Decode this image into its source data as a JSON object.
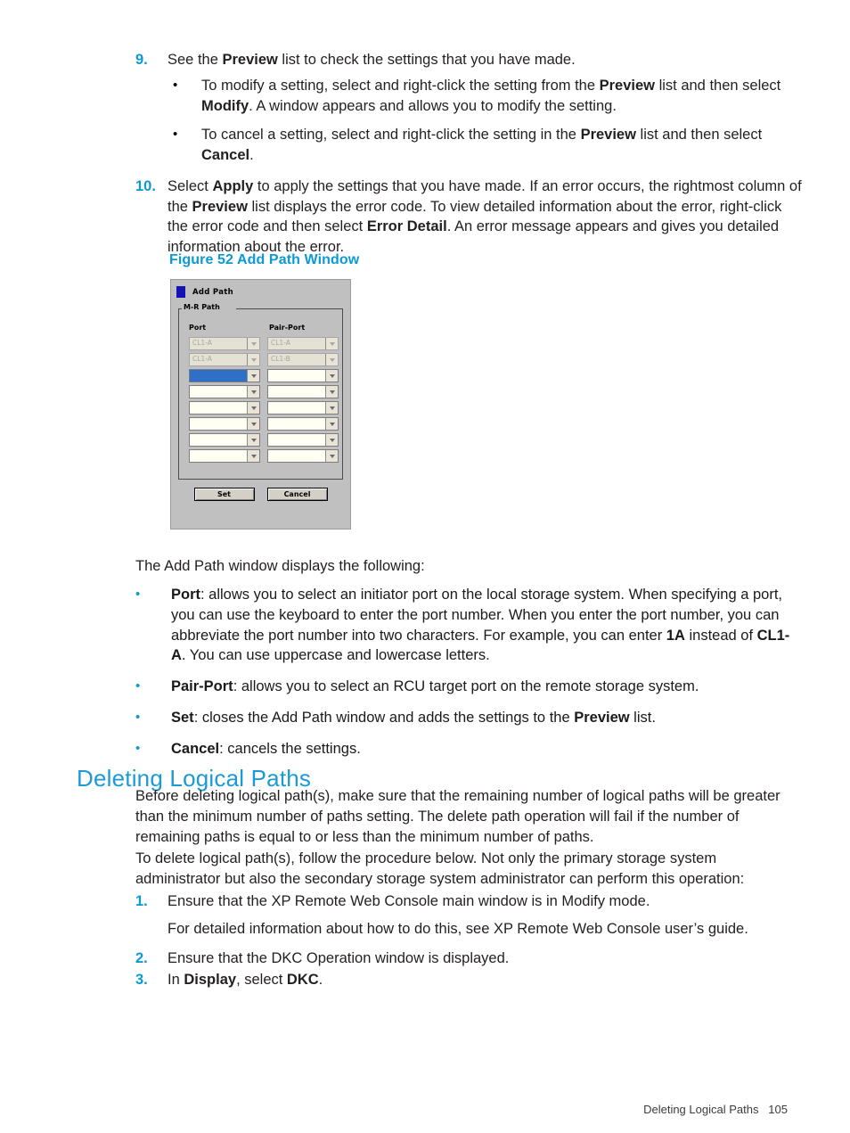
{
  "steps_top": [
    {
      "marker": "9.",
      "text_parts": [
        {
          "t": "See the ",
          "b": false
        },
        {
          "t": "Preview",
          "b": true
        },
        {
          "t": " list to check the settings that you have made.",
          "b": false
        }
      ],
      "sub_bullets": [
        {
          "marker": "•",
          "text_parts": [
            {
              "t": "To modify a setting, select and right-click the setting from the ",
              "b": false
            },
            {
              "t": "Preview",
              "b": true
            },
            {
              "t": " list and then select ",
              "b": false
            },
            {
              "t": "Modify",
              "b": true
            },
            {
              "t": ". A window appears and allows you to modify the setting.",
              "b": false
            }
          ]
        },
        {
          "marker": "•",
          "text_parts": [
            {
              "t": "To cancel a setting, select and right-click the setting in the ",
              "b": false
            },
            {
              "t": "Preview",
              "b": true
            },
            {
              "t": " list and then select ",
              "b": false
            },
            {
              "t": "Cancel",
              "b": true
            },
            {
              "t": ".",
              "b": false
            }
          ]
        }
      ]
    },
    {
      "marker": "10.",
      "text_parts": [
        {
          "t": "Select ",
          "b": false
        },
        {
          "t": "Apply",
          "b": true
        },
        {
          "t": " to apply the settings that you have made. If an error occurs, the rightmost column of the ",
          "b": false
        },
        {
          "t": "Preview",
          "b": true
        },
        {
          "t": " list displays the error code. To view detailed information about the error, right-click the error code and then select ",
          "b": false
        },
        {
          "t": "Error Detail",
          "b": true
        },
        {
          "t": ". An error message appears and gives you detailed information about the error.",
          "b": false
        }
      ],
      "sub_bullets": []
    }
  ],
  "figure": {
    "caption": "Figure 52 Add Path Window",
    "dialog": {
      "title": "Add Path",
      "icon": "app-square-icon",
      "group_legend": "M-R Path",
      "columns": [
        "Port",
        "Pair-Port"
      ],
      "rows": [
        {
          "port": "CL1-A",
          "pair_port": "CL1-A",
          "state": "disabled"
        },
        {
          "port": "CL1-A",
          "pair_port": "CL1-B",
          "state": "disabled"
        },
        {
          "port": "",
          "pair_port": "",
          "state": "selected"
        },
        {
          "port": "",
          "pair_port": "",
          "state": "empty"
        },
        {
          "port": "",
          "pair_port": "",
          "state": "empty"
        },
        {
          "port": "",
          "pair_port": "",
          "state": "empty"
        },
        {
          "port": "",
          "pair_port": "",
          "state": "empty"
        },
        {
          "port": "",
          "pair_port": "",
          "state": "empty"
        }
      ],
      "buttons": {
        "set": "Set",
        "cancel": "Cancel"
      }
    }
  },
  "intro_after_figure": "The Add Path window displays the following:",
  "field_bullets": [
    {
      "marker": "•",
      "text_parts": [
        {
          "t": "Port",
          "b": true
        },
        {
          "t": ": allows you to select an initiator port on the local storage system. When specifying a port, you can use the keyboard to enter the port number. When you enter the port number, you can abbreviate the port number into two characters. For example, you can enter ",
          "b": false
        },
        {
          "t": "1A",
          "b": true
        },
        {
          "t": " instead of ",
          "b": false
        },
        {
          "t": "CL1-A",
          "b": true
        },
        {
          "t": ". You can use uppercase and lowercase letters.",
          "b": false
        }
      ]
    },
    {
      "marker": "•",
      "text_parts": [
        {
          "t": "Pair-Port",
          "b": true
        },
        {
          "t": ": allows you to select an RCU target port on the remote storage system.",
          "b": false
        }
      ]
    },
    {
      "marker": "•",
      "text_parts": [
        {
          "t": "Set",
          "b": true
        },
        {
          "t": ": closes the Add Path window and adds the settings to the ",
          "b": false
        },
        {
          "t": "Preview",
          "b": true
        },
        {
          "t": " list.",
          "b": false
        }
      ]
    },
    {
      "marker": "•",
      "text_parts": [
        {
          "t": "Cancel",
          "b": true
        },
        {
          "t": ": cancels the settings.",
          "b": false
        }
      ]
    }
  ],
  "section": {
    "heading": "Deleting Logical Paths",
    "paragraph1": "Before deleting logical path(s), make sure that the remaining number of logical paths will be greater than the minimum number of paths setting. The delete path operation will fail if the number of remaining paths is equal to or less than the minimum number of paths.",
    "paragraph2": "To delete logical path(s), follow the procedure below. Not only the primary storage system administrator but also the secondary storage system administrator can perform this operation:"
  },
  "steps_bottom": [
    {
      "marker": "1.",
      "text_parts": [
        {
          "t": "Ensure that the XP Remote Web Console main window is in Modify mode.",
          "b": false
        }
      ],
      "continuation": "For detailed information about how to do this, see XP Remote Web Console user’s guide."
    },
    {
      "marker": "2.",
      "text_parts": [
        {
          "t": "Ensure that the DKC Operation window is displayed.",
          "b": false
        }
      ],
      "continuation": ""
    },
    {
      "marker": "3.",
      "text_parts": [
        {
          "t": "In ",
          "b": false
        },
        {
          "t": "Display",
          "b": true
        },
        {
          "t": ", select ",
          "b": false
        },
        {
          "t": "DKC",
          "b": true
        },
        {
          "t": ".",
          "b": false
        }
      ],
      "continuation": ""
    }
  ],
  "footer": {
    "section_label": "Deleting Logical Paths",
    "page_number": "105"
  },
  "colors": {
    "accent_blue": "#0b9ad6",
    "heading_blue": "#1b9ad6",
    "text": "#231f20",
    "dialog_face": "#c0c0c0",
    "selection_blue": "#2f6fc7",
    "dialog_icon_blue": "#1414b4"
  }
}
